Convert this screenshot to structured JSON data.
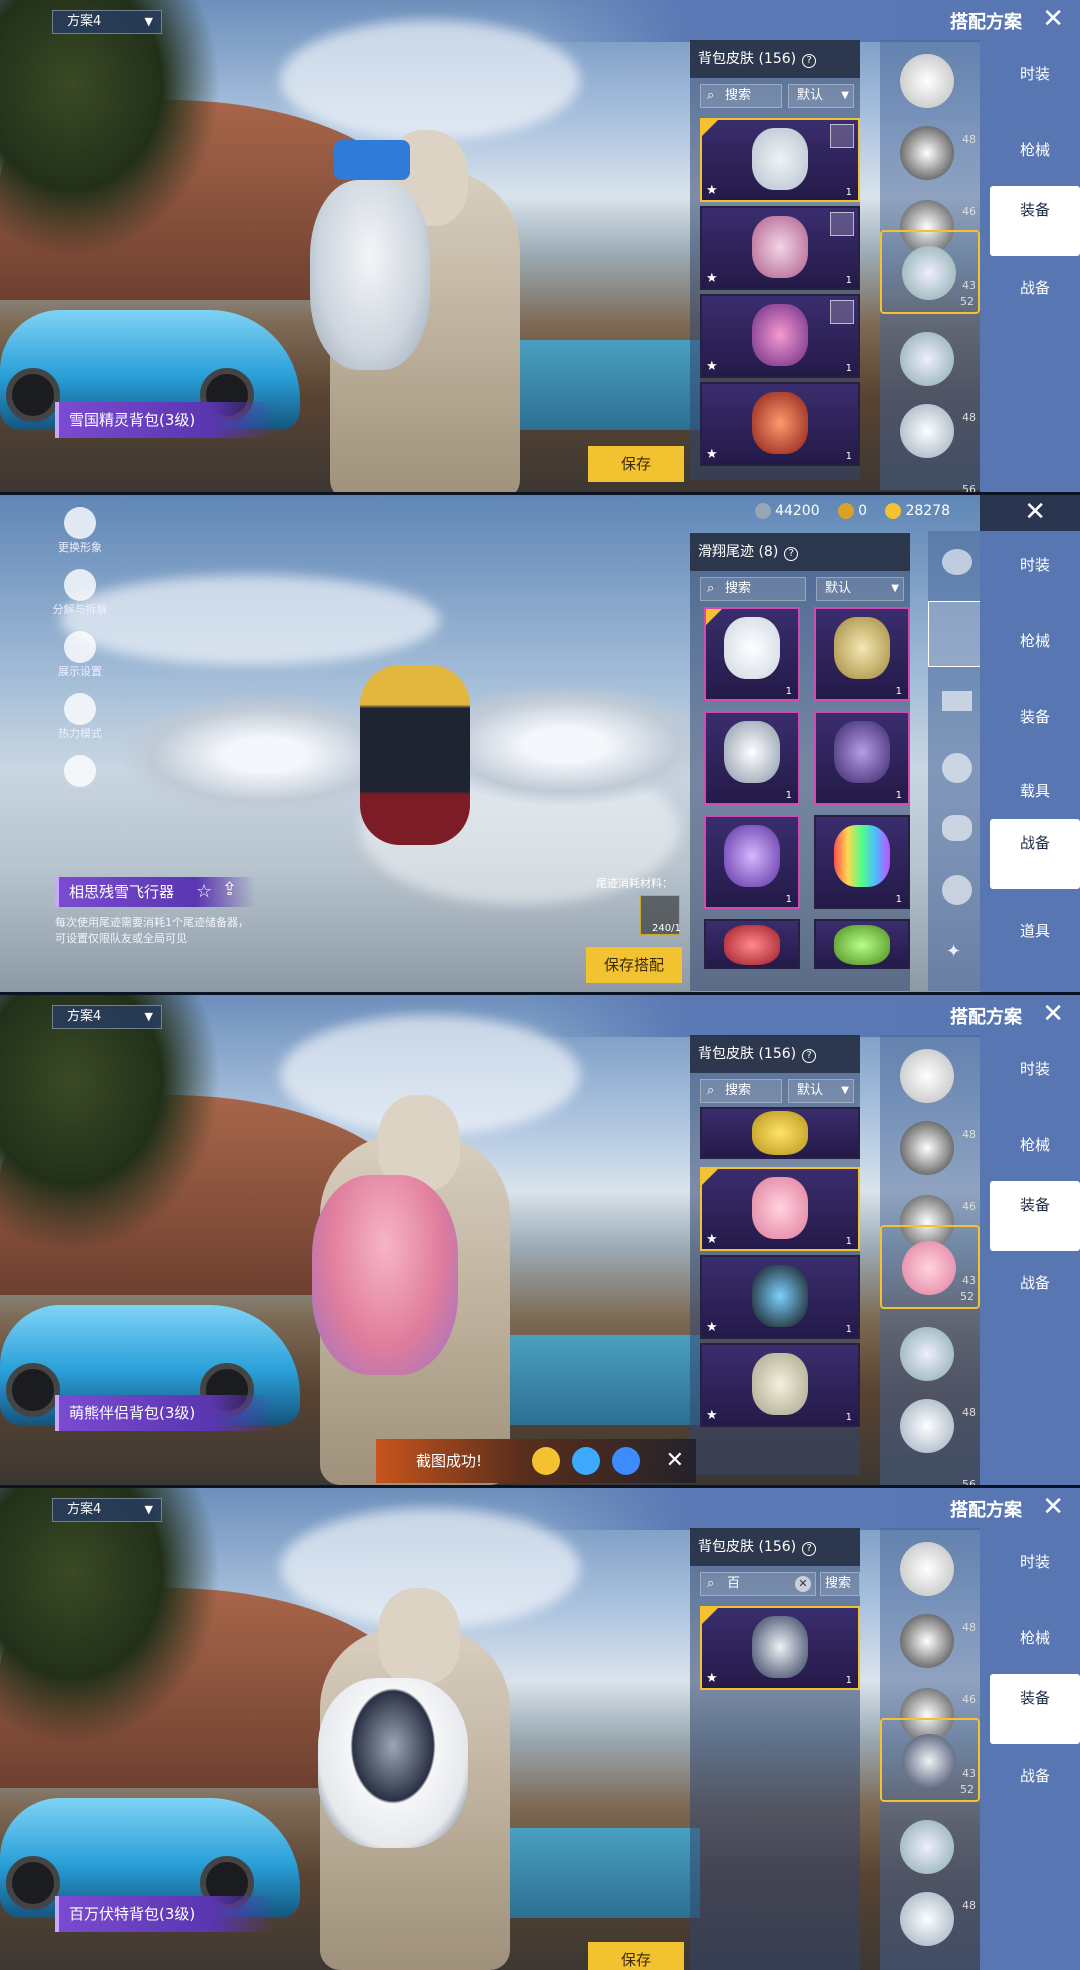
{
  "plan_label": "方案4",
  "outfit_title": "搭配方案",
  "close_glyph": "✕",
  "backpack_grid": {
    "title": "背包皮肤 (156)",
    "help_glyph": "?",
    "search_placeholder": "搜索",
    "sort_label": "默认",
    "qty": "1"
  },
  "nav_tabs": [
    "时装",
    "枪械",
    "装备",
    "战备"
  ],
  "side_levels": [
    "48",
    "46",
    "43",
    "52",
    "48",
    "56"
  ],
  "panel1": {
    "item_label": "雪国精灵背包(3级)",
    "save_label": "保存"
  },
  "panel2": {
    "currency": {
      "silver": "44200",
      "gold": "0",
      "coupon": "28278"
    },
    "left_tools": [
      "更换形象",
      "分解与拆解",
      "展示设置",
      "热力模式"
    ],
    "item_label": "相思残雪飞行器",
    "desc": "每次使用尾迹需要消耗1个尾迹储备器，可设置仅限队友或全局可见",
    "material_label": "尾迹消耗材料：",
    "material_count": "240/1",
    "grid_title": "滑翔尾迹 (8)",
    "right_tabs": [
      "时装",
      "枪械",
      "装备",
      "载具",
      "战备",
      "道具"
    ],
    "save_label": "保存搭配"
  },
  "panel3": {
    "item_label": "萌熊伴侣背包(3级)",
    "toast": "截图成功!"
  },
  "panel4": {
    "item_label": "百万伏特背包(3级)",
    "search_value": "百",
    "search_button": "搜索",
    "save_label": "保存"
  },
  "colors": {
    "accent": "#f2c230",
    "nav": "#5876b2",
    "label": "#7a4bd0"
  }
}
